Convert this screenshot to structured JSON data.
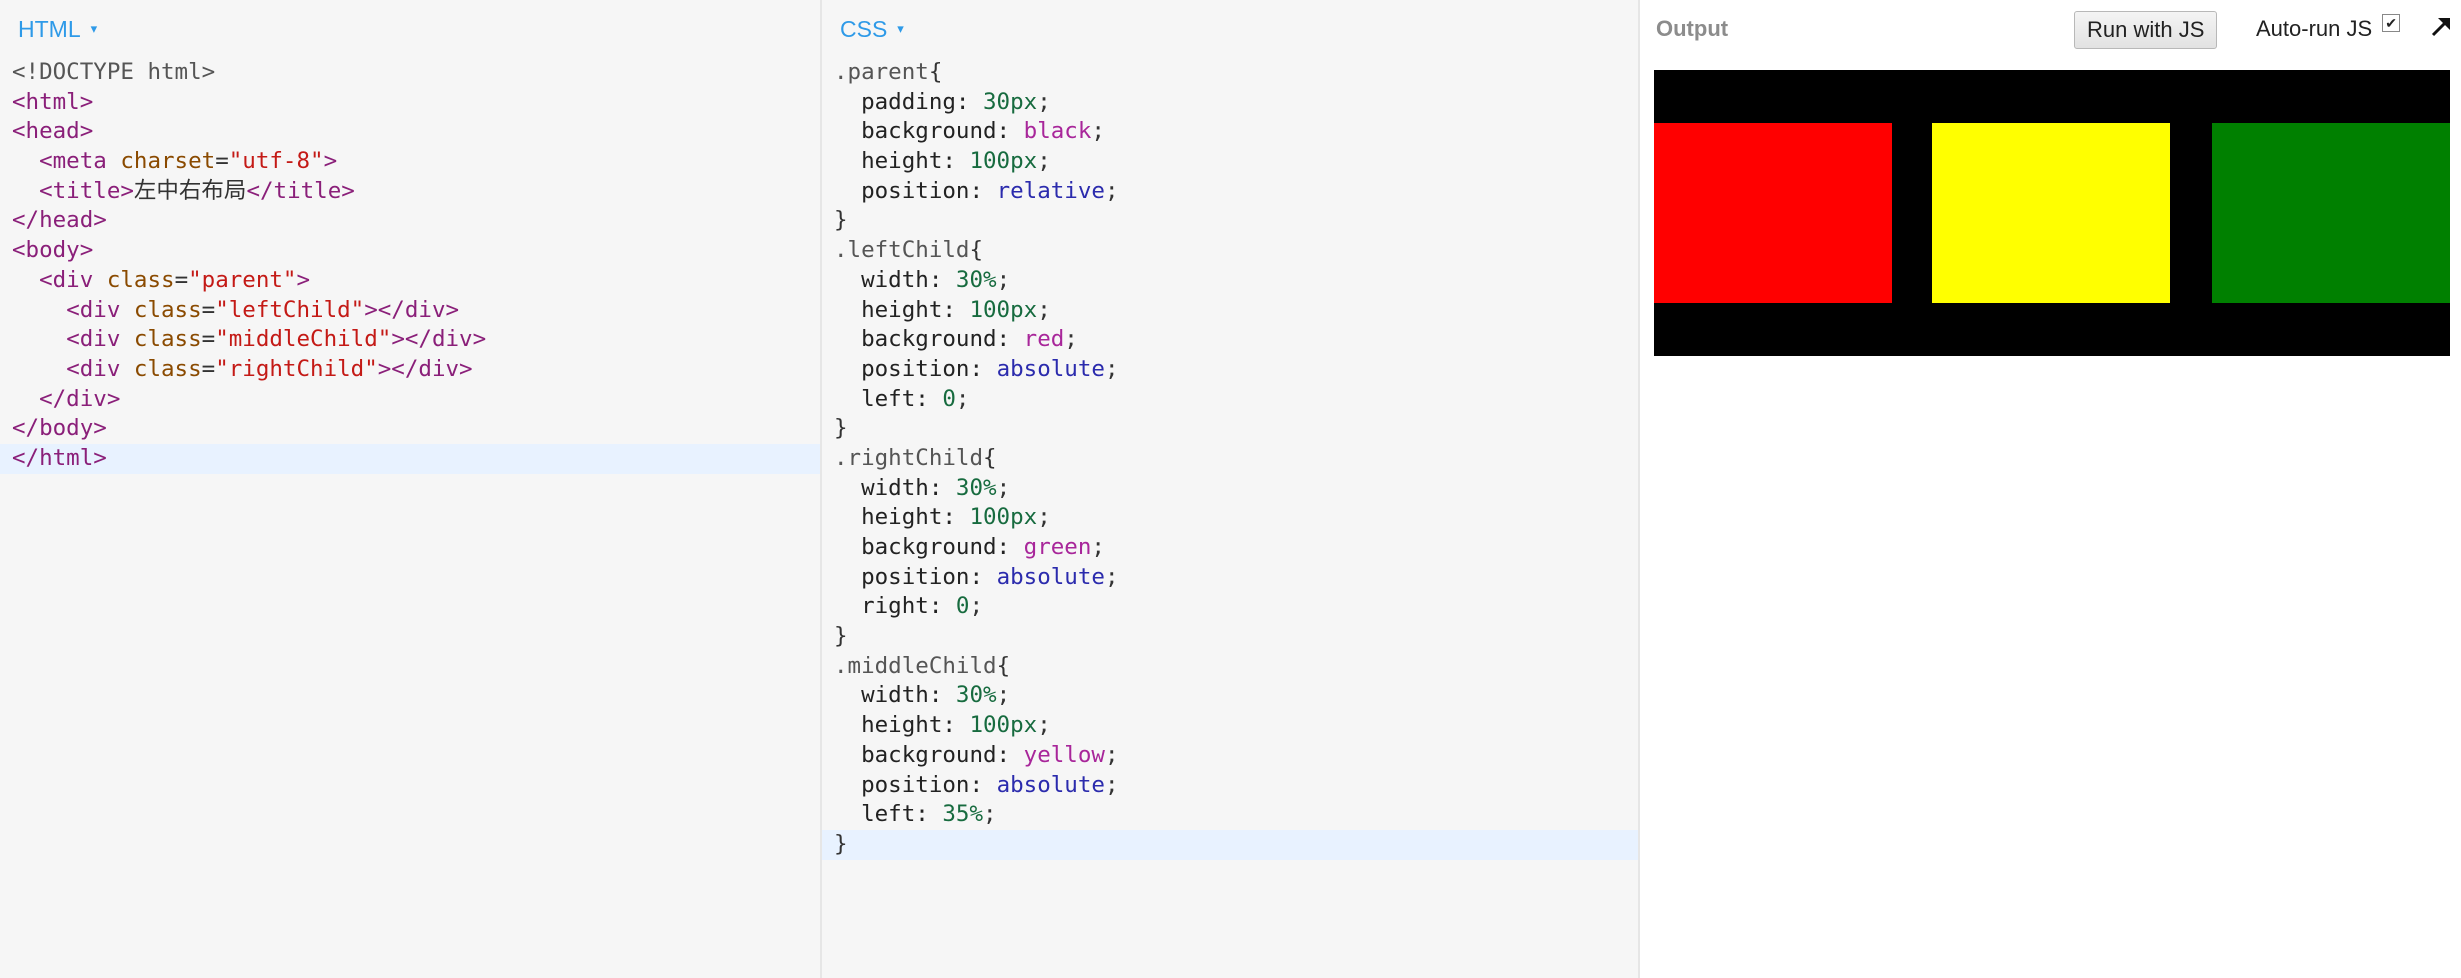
{
  "panels": {
    "html": {
      "label": "HTML",
      "caret": "▾"
    },
    "css": {
      "label": "CSS",
      "caret": "▾"
    },
    "output": {
      "label": "Output",
      "run_button": "Run with JS",
      "autorun_label": "Auto-run JS",
      "autorun_checked": true,
      "checkbox_glyph": "✔",
      "expand_icon": "arrow-up-right-icon"
    }
  },
  "html_code": [
    [
      [
        "t-doctype",
        "<!DOCTYPE html>"
      ]
    ],
    [
      [
        "t-tag",
        "<html>"
      ]
    ],
    [
      [
        "t-tag",
        "<head>"
      ]
    ],
    [
      [
        "t-plain",
        "  "
      ],
      [
        "t-tag",
        "<meta "
      ],
      [
        "t-attr",
        "charset"
      ],
      [
        "t-plain",
        "="
      ],
      [
        "t-str",
        "\"utf-8\""
      ],
      [
        "t-tag",
        ">"
      ]
    ],
    [
      [
        "t-plain",
        "  "
      ],
      [
        "t-tag",
        "<title>"
      ],
      [
        "t-text",
        "左中右布局"
      ],
      [
        "t-tag",
        "</title>"
      ]
    ],
    [
      [
        "t-tag",
        "</head>"
      ]
    ],
    [
      [
        "t-tag",
        "<body>"
      ]
    ],
    [
      [
        "t-plain",
        "  "
      ],
      [
        "t-tag",
        "<div "
      ],
      [
        "t-attr",
        "class"
      ],
      [
        "t-plain",
        "="
      ],
      [
        "t-str",
        "\"parent\""
      ],
      [
        "t-tag",
        ">"
      ]
    ],
    [
      [
        "t-plain",
        "    "
      ],
      [
        "t-tag",
        "<div "
      ],
      [
        "t-attr",
        "class"
      ],
      [
        "t-plain",
        "="
      ],
      [
        "t-str",
        "\"leftChild\""
      ],
      [
        "t-tag",
        "></div>"
      ]
    ],
    [
      [
        "t-plain",
        "    "
      ],
      [
        "t-tag",
        "<div "
      ],
      [
        "t-attr",
        "class"
      ],
      [
        "t-plain",
        "="
      ],
      [
        "t-str",
        "\"middleChild\""
      ],
      [
        "t-tag",
        "></div>"
      ]
    ],
    [
      [
        "t-plain",
        "    "
      ],
      [
        "t-tag",
        "<div "
      ],
      [
        "t-attr",
        "class"
      ],
      [
        "t-plain",
        "="
      ],
      [
        "t-str",
        "\"rightChild\""
      ],
      [
        "t-tag",
        "></div>"
      ]
    ],
    [
      [
        "t-plain",
        "  "
      ],
      [
        "t-tag",
        "</div>"
      ]
    ],
    [
      [
        "t-tag",
        "</body>"
      ]
    ],
    [
      [
        "t-tag",
        "</html>"
      ]
    ]
  ],
  "html_active_line": 13,
  "css_code": [
    [
      [
        "t-sel",
        ".parent"
      ],
      [
        "t-punc",
        "{"
      ]
    ],
    [
      [
        "t-prop",
        "  padding: "
      ],
      [
        "t-num",
        "30px"
      ],
      [
        "t-punc",
        ";"
      ]
    ],
    [
      [
        "t-prop",
        "  background: "
      ],
      [
        "t-kw",
        "black"
      ],
      [
        "t-punc",
        ";"
      ]
    ],
    [
      [
        "t-prop",
        "  height: "
      ],
      [
        "t-num",
        "100px"
      ],
      [
        "t-punc",
        ";"
      ]
    ],
    [
      [
        "t-prop",
        "  position: "
      ],
      [
        "t-val",
        "relative"
      ],
      [
        "t-punc",
        ";"
      ]
    ],
    [
      [
        "t-punc",
        "}"
      ]
    ],
    [
      [
        "t-sel",
        ".leftChild"
      ],
      [
        "t-punc",
        "{"
      ]
    ],
    [
      [
        "t-prop",
        "  width: "
      ],
      [
        "t-num",
        "30%"
      ],
      [
        "t-punc",
        ";"
      ]
    ],
    [
      [
        "t-prop",
        "  height: "
      ],
      [
        "t-num",
        "100px"
      ],
      [
        "t-punc",
        ";"
      ]
    ],
    [
      [
        "t-prop",
        "  background: "
      ],
      [
        "t-kw",
        "red"
      ],
      [
        "t-punc",
        ";"
      ]
    ],
    [
      [
        "t-prop",
        "  position: "
      ],
      [
        "t-val",
        "absolute"
      ],
      [
        "t-punc",
        ";"
      ]
    ],
    [
      [
        "t-prop",
        "  left: "
      ],
      [
        "t-num",
        "0"
      ],
      [
        "t-punc",
        ";"
      ]
    ],
    [
      [
        "t-punc",
        "}"
      ]
    ],
    [
      [
        "t-sel",
        ".rightChild"
      ],
      [
        "t-punc",
        "{"
      ]
    ],
    [
      [
        "t-prop",
        "  width: "
      ],
      [
        "t-num",
        "30%"
      ],
      [
        "t-punc",
        ";"
      ]
    ],
    [
      [
        "t-prop",
        "  height: "
      ],
      [
        "t-num",
        "100px"
      ],
      [
        "t-punc",
        ";"
      ]
    ],
    [
      [
        "t-prop",
        "  background: "
      ],
      [
        "t-kw",
        "green"
      ],
      [
        "t-punc",
        ";"
      ]
    ],
    [
      [
        "t-prop",
        "  position: "
      ],
      [
        "t-val",
        "absolute"
      ],
      [
        "t-punc",
        ";"
      ]
    ],
    [
      [
        "t-prop",
        "  right: "
      ],
      [
        "t-num",
        "0"
      ],
      [
        "t-punc",
        ";"
      ]
    ],
    [
      [
        "t-punc",
        "}"
      ]
    ],
    [
      [
        "t-sel",
        ".middleChild"
      ],
      [
        "t-punc",
        "{"
      ]
    ],
    [
      [
        "t-prop",
        "  width: "
      ],
      [
        "t-num",
        "30%"
      ],
      [
        "t-punc",
        ";"
      ]
    ],
    [
      [
        "t-prop",
        "  height: "
      ],
      [
        "t-num",
        "100px"
      ],
      [
        "t-punc",
        ";"
      ]
    ],
    [
      [
        "t-prop",
        "  background: "
      ],
      [
        "t-kw",
        "yellow"
      ],
      [
        "t-punc",
        ";"
      ]
    ],
    [
      [
        "t-prop",
        "  position: "
      ],
      [
        "t-val",
        "absolute"
      ],
      [
        "t-punc",
        ";"
      ]
    ],
    [
      [
        "t-prop",
        "  left: "
      ],
      [
        "t-num",
        "35%"
      ],
      [
        "t-punc",
        ";"
      ]
    ],
    [
      [
        "t-punc",
        "}"
      ]
    ]
  ],
  "css_active_line": 26,
  "output_render": {
    "parent_color": "#000000",
    "left_color": "#ff0000",
    "middle_color": "#ffff00",
    "right_color": "#008000"
  },
  "colors": {
    "accent": "#2e9ae8",
    "active_line": "#e8f2ff"
  }
}
